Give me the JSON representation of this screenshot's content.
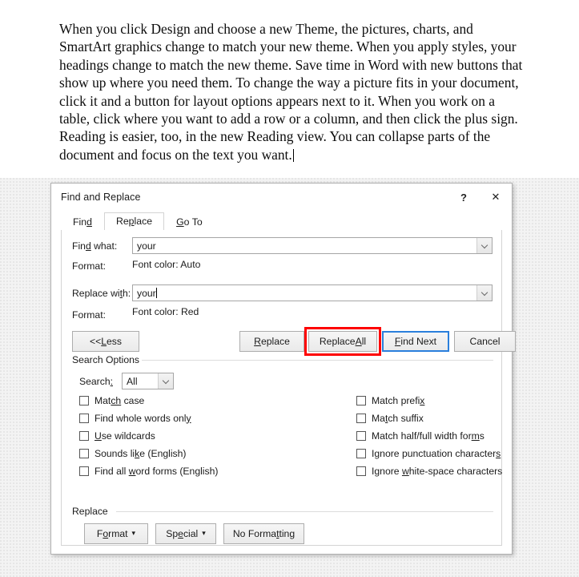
{
  "document": {
    "paragraph": "When you click Design and choose a new Theme, the pictures, charts, and SmartArt graphics change to match your new theme. When you apply styles, your headings change to match the new theme. Save time in Word with new buttons that show up where you need them. To change the way a picture fits in your document, click it and a button for layout options appears next to it. When you work on a table, click where you want to add a row or a column, and then click the plus sign. Reading is easier, too, in the new Reading view. You can collapse parts of the document and focus on the text you want."
  },
  "dialog": {
    "title": "Find and Replace",
    "help_button": "?",
    "close_button": "✕",
    "tabs": [
      {
        "label_pre": "Fin",
        "accel": "d",
        "label_post": "",
        "active": false,
        "name": "find"
      },
      {
        "label_pre": "Re",
        "accel": "p",
        "label_post": "lace",
        "active": true,
        "name": "replace"
      },
      {
        "label_pre": "",
        "accel": "G",
        "label_post": "o To",
        "active": false,
        "name": "go-to"
      }
    ],
    "find": {
      "label_pre": "Fin",
      "label_accel": "d",
      "label_post": " what:",
      "value": "your",
      "format_label": "Format:",
      "format_value": "Font color: Auto"
    },
    "replace": {
      "label_pre": "Replace wi",
      "label_accel": "t",
      "label_post": "h:",
      "value": "your",
      "format_label": "Format:",
      "format_value": "Font color: Red"
    },
    "buttons": {
      "less": {
        "pre": "<< ",
        "accel": "L",
        "post": "ess"
      },
      "replace": {
        "pre": "",
        "accel": "R",
        "post": "eplace"
      },
      "replace_all": {
        "pre": "Replace ",
        "accel": "A",
        "post": "ll"
      },
      "find_next": {
        "pre": "",
        "accel": "F",
        "post": "ind Next"
      },
      "cancel": {
        "pre": "Cancel",
        "accel": "",
        "post": ""
      }
    },
    "search_options": {
      "group_label": "Search Options",
      "search_label_pre": "Search",
      "search_label_accel": ":",
      "search_value": "All",
      "checkboxes_left": [
        {
          "pre": "Mat",
          "accel": "ch",
          "post": " case",
          "checked": false,
          "name": "match-case"
        },
        {
          "pre": "Find whole words onl",
          "accel": "y",
          "post": "",
          "checked": false,
          "name": "find-whole-words-only"
        },
        {
          "pre": "",
          "accel": "U",
          "post": "se wildcards",
          "checked": false,
          "name": "use-wildcards"
        },
        {
          "pre": "Sounds li",
          "accel": "k",
          "post": "e (English)",
          "checked": false,
          "name": "sounds-like"
        },
        {
          "pre": "Find all ",
          "accel": "w",
          "post": "ord forms (English)",
          "checked": false,
          "name": "find-all-word-forms"
        }
      ],
      "checkboxes_right": [
        {
          "pre": "Match prefi",
          "accel": "x",
          "post": "",
          "checked": false,
          "name": "match-prefix"
        },
        {
          "pre": "Ma",
          "accel": "t",
          "post": "ch suffix",
          "checked": false,
          "name": "match-suffix"
        },
        {
          "pre": "Match half/full width for",
          "accel": "m",
          "post": "s",
          "checked": false,
          "name": "match-half-full-width-forms"
        },
        {
          "pre": "Ignore punctuation character",
          "accel": "s",
          "post": "",
          "checked": false,
          "name": "ignore-punctuation-characters"
        },
        {
          "pre": "Ignore ",
          "accel": "w",
          "post": "hite-space characters",
          "checked": false,
          "name": "ignore-white-space-characters"
        }
      ]
    },
    "replace_group": {
      "group_label": "Replace",
      "format_button": {
        "pre": "F",
        "accel": "o",
        "post": "rmat",
        "caret": "▾"
      },
      "special_button": {
        "pre": "Sp",
        "accel": "e",
        "post": "cial",
        "caret": "▾"
      },
      "no_formatting_button": {
        "pre": "No Forma",
        "accel": "t",
        "post": "ting"
      }
    }
  },
  "annotation": {
    "highlight_color": "#fe0000",
    "highlighted_control": "Replace All",
    "focus_color": "#2a7fdc"
  }
}
